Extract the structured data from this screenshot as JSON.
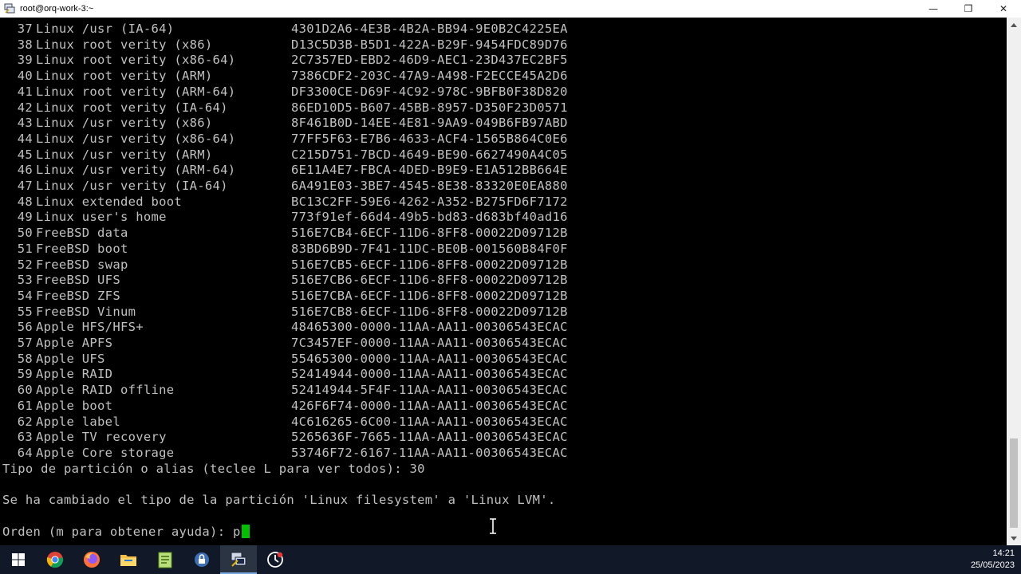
{
  "window": {
    "title": "root@orq-work-3:~",
    "minimize_glyph": "—",
    "maximize_glyph": "❐",
    "close_glyph": "✕"
  },
  "terminal": {
    "rows": [
      {
        "num": "37",
        "name": "Linux /usr (IA-64)",
        "guid": "4301D2A6-4E3B-4B2A-BB94-9E0B2C4225EA"
      },
      {
        "num": "38",
        "name": "Linux root verity (x86)",
        "guid": "D13C5D3B-B5D1-422A-B29F-9454FDC89D76"
      },
      {
        "num": "39",
        "name": "Linux root verity (x86-64)",
        "guid": "2C7357ED-EBD2-46D9-AEC1-23D437EC2BF5"
      },
      {
        "num": "40",
        "name": "Linux root verity (ARM)",
        "guid": "7386CDF2-203C-47A9-A498-F2ECCE45A2D6"
      },
      {
        "num": "41",
        "name": "Linux root verity (ARM-64)",
        "guid": "DF3300CE-D69F-4C92-978C-9BFB0F38D820"
      },
      {
        "num": "42",
        "name": "Linux root verity (IA-64)",
        "guid": "86ED10D5-B607-45BB-8957-D350F23D0571"
      },
      {
        "num": "43",
        "name": "Linux /usr verity (x86)",
        "guid": "8F461B0D-14EE-4E81-9AA9-049B6FB97ABD"
      },
      {
        "num": "44",
        "name": "Linux /usr verity (x86-64)",
        "guid": "77FF5F63-E7B6-4633-ACF4-1565B864C0E6"
      },
      {
        "num": "45",
        "name": "Linux /usr verity (ARM)",
        "guid": "C215D751-7BCD-4649-BE90-6627490A4C05"
      },
      {
        "num": "46",
        "name": "Linux /usr verity (ARM-64)",
        "guid": "6E11A4E7-FBCA-4DED-B9E9-E1A512BB664E"
      },
      {
        "num": "47",
        "name": "Linux /usr verity (IA-64)",
        "guid": "6A491E03-3BE7-4545-8E38-83320E0EA880"
      },
      {
        "num": "48",
        "name": "Linux extended boot",
        "guid": "BC13C2FF-59E6-4262-A352-B275FD6F7172"
      },
      {
        "num": "49",
        "name": "Linux user's home",
        "guid": "773f91ef-66d4-49b5-bd83-d683bf40ad16"
      },
      {
        "num": "50",
        "name": "FreeBSD data",
        "guid": "516E7CB4-6ECF-11D6-8FF8-00022D09712B"
      },
      {
        "num": "51",
        "name": "FreeBSD boot",
        "guid": "83BD6B9D-7F41-11DC-BE0B-001560B84F0F"
      },
      {
        "num": "52",
        "name": "FreeBSD swap",
        "guid": "516E7CB5-6ECF-11D6-8FF8-00022D09712B"
      },
      {
        "num": "53",
        "name": "FreeBSD UFS",
        "guid": "516E7CB6-6ECF-11D6-8FF8-00022D09712B"
      },
      {
        "num": "54",
        "name": "FreeBSD ZFS",
        "guid": "516E7CBA-6ECF-11D6-8FF8-00022D09712B"
      },
      {
        "num": "55",
        "name": "FreeBSD Vinum",
        "guid": "516E7CB8-6ECF-11D6-8FF8-00022D09712B"
      },
      {
        "num": "56",
        "name": "Apple HFS/HFS+",
        "guid": "48465300-0000-11AA-AA11-00306543ECAC"
      },
      {
        "num": "57",
        "name": "Apple APFS",
        "guid": "7C3457EF-0000-11AA-AA11-00306543ECAC"
      },
      {
        "num": "58",
        "name": "Apple UFS",
        "guid": "55465300-0000-11AA-AA11-00306543ECAC"
      },
      {
        "num": "59",
        "name": "Apple RAID",
        "guid": "52414944-0000-11AA-AA11-00306543ECAC"
      },
      {
        "num": "60",
        "name": "Apple RAID offline",
        "guid": "52414944-5F4F-11AA-AA11-00306543ECAC"
      },
      {
        "num": "61",
        "name": "Apple boot",
        "guid": "426F6F74-0000-11AA-AA11-00306543ECAC"
      },
      {
        "num": "62",
        "name": "Apple label",
        "guid": "4C616265-6C00-11AA-AA11-00306543ECAC"
      },
      {
        "num": "63",
        "name": "Apple TV recovery",
        "guid": "5265636F-7665-11AA-AA11-00306543ECAC"
      },
      {
        "num": "64",
        "name": "Apple Core storage",
        "guid": "53746F72-6167-11AA-AA11-00306543ECAC"
      }
    ],
    "partition_prompt": "Tipo de partición o alias (teclee L para ver todos): 30",
    "changed_message": "Se ha cambiado el tipo de la partición 'Linux filesystem' a 'Linux LVM'.",
    "command_prompt": "Orden (m para obtener ayuda): ",
    "command_input": "p"
  },
  "taskbar": {
    "icons": [
      "windows-start-icon",
      "chrome-icon",
      "firefox-icon",
      "file-explorer-icon",
      "notepad-plus-icon",
      "keepass-icon",
      "putty-icon",
      "activity-icon"
    ],
    "active": "putty-icon",
    "time": "14:21",
    "date": "25/05/2023"
  }
}
